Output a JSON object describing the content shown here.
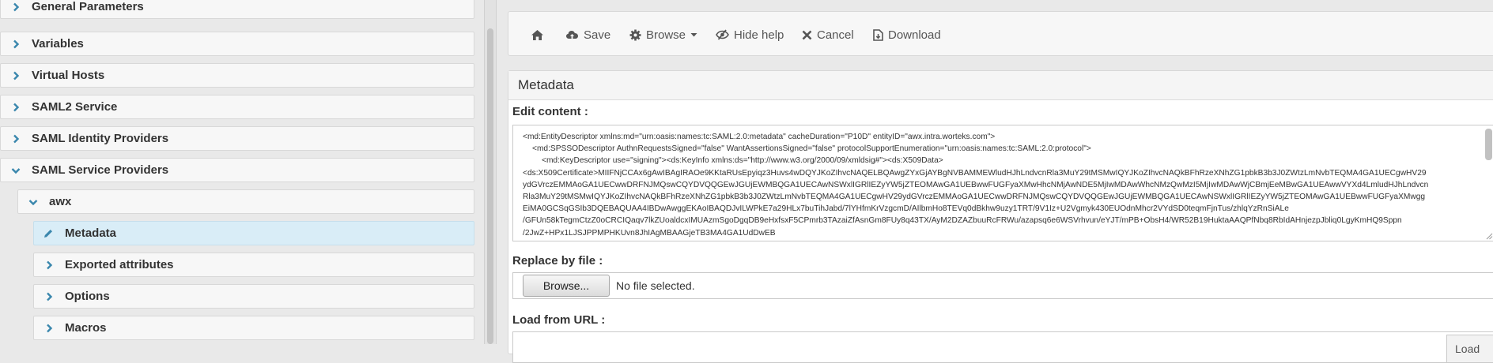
{
  "sidebar": {
    "items": [
      {
        "label": "General Parameters",
        "state": "collapsed"
      },
      {
        "label": "Variables",
        "state": "collapsed"
      },
      {
        "label": "Virtual Hosts",
        "state": "collapsed"
      },
      {
        "label": "SAML2 Service",
        "state": "collapsed"
      },
      {
        "label": "SAML Identity Providers",
        "state": "collapsed"
      },
      {
        "label": "SAML Service Providers",
        "state": "expanded"
      },
      {
        "label": "awx",
        "state": "expanded"
      },
      {
        "label": "Metadata",
        "state": "selected"
      },
      {
        "label": "Exported attributes",
        "state": "collapsed"
      },
      {
        "label": "Options",
        "state": "collapsed"
      },
      {
        "label": "Macros",
        "state": "collapsed"
      }
    ]
  },
  "toolbar": {
    "home_icon": "home-icon",
    "save_label": "Save",
    "browse_label": "Browse",
    "hide_help_label": "Hide help",
    "cancel_label": "Cancel",
    "download_label": "Download"
  },
  "panel": {
    "title": "Metadata",
    "edit_content_label": "Edit content :",
    "editor_lines": [
      "<md:EntityDescriptor xmlns:md=\"urn:oasis:names:tc:SAML:2.0:metadata\" cacheDuration=\"P10D\" entityID=\"awx.intra.worteks.com\">",
      "<md:SPSSODescriptor AuthnRequestsSigned=\"false\" WantAssertionsSigned=\"false\" protocolSupportEnumeration=\"urn:oasis:names:tc:SAML:2.0:protocol\">",
      "<md:KeyDescriptor use=\"signing\"><ds:KeyInfo xmlns:ds=\"http://www.w3.org/2000/09/xmldsig#\"><ds:X509Data>",
      "<ds:X509Certificate>MIIFNjCCAx6gAwIBAgIRAOe9KKtaRUsEpyiqz3Huvs4wDQYJKoZIhvcNAQELBQAwgZYxGjAYBgNVBAMMEWludHJhLndvcnRla3MuY29tMSMwIQYJKoZIhvcNAQkBFhRzeXNhZG1pbkB3b3J0ZWtzLmNvbTEQMA4GA1UECgwHV29",
      "ydGVrczEMMAoGA1UECwwDRFNJMQswCQYDVQQGEwJGUjEWMBQGA1UECAwNSWxlIGRlIEZyYW5jZTEOMAwGA1UEBwwFUGFyaXMwHhcNMjAwNDE5MjIwMDAwWhcNMzQwMzI5MjIwMDAwWjCBmjEeMBwGA1UEAwwVYXd4LmludHJhLndvcn",
      "Rla3MuY29tMSMwIQYJKoZIhvcNAQkBFhRzeXNhZG1pbkB3b3J0ZWtzLmNvbTEQMA4GA1UECgwHV29ydGVrczEMMAoGA1UECwwDRFNJMQswCQYDVQQGEwJGUjEWMBQGA1UECAwNSWxlIGRlIEZyYW5jZTEOMAwGA1UEBwwFUGFyaXMwgg",
      "EiMA0GCSqGSIb3DQEBAQUAA4IBDwAwggEKAoIBAQDJvILWPkE7a29HLx7buTihJabd/7lYHfmKrVzgcmD/AIlbmHo8TEVq0dBkhw9uzy1TRT/9V1Iz+U2Vgmyk430EUOdnMhcr2VYdSD0teqmFjnTus/zhlqYzRnSiALe",
      "/GFUn58kTegmCtzZ0oCRCIQaqv7lkZUoaldcxIMUAzmSgoDgqDB9eHxfsxF5CPmrb3TAzaiZfAsnGm8FUy8q43TX/AyM2DZAZbuuRcFRWu/azapsq6e6WSVrhvun/eYJT/mPB+ObsH4/WR52B19HuktaAAQPfNbq8RbIdAHnjezpJbliq0LgyKmHQ9Sppn",
      "/2JwZ+HPx1LJSJPPMPHKUvn8JhIAgMBAAGjeTB3MA4GA1UdDwEB"
    ],
    "replace_label": "Replace by file :",
    "browse_file_label": "Browse...",
    "file_status": "No file selected.",
    "load_url_label": "Load from URL :",
    "load_button_label": "Load"
  }
}
